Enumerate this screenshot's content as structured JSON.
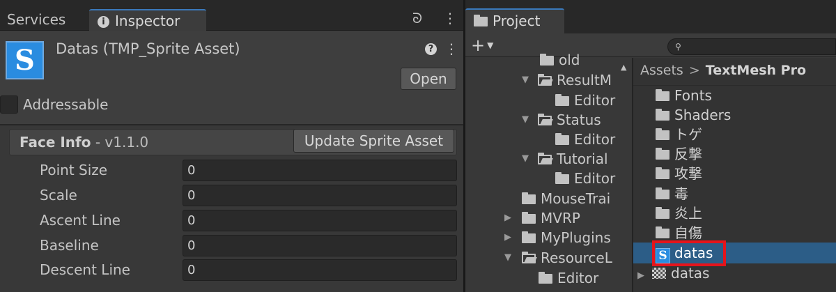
{
  "inspector": {
    "tabs": {
      "services": "Services",
      "inspector": "Inspector"
    },
    "asset": {
      "icon_letter": "S",
      "title": "Datas (TMP_Sprite Asset)",
      "open_button": "Open",
      "addressable_label": "Addressable",
      "addressable_checked": false
    },
    "face_info": {
      "title": "Face Info",
      "version": " - v1.1.0",
      "update_button": "Update Sprite Asset",
      "properties": [
        {
          "label": "Point Size",
          "value": "0"
        },
        {
          "label": "Scale",
          "value": "0"
        },
        {
          "label": "Ascent Line",
          "value": "0"
        },
        {
          "label": "Baseline",
          "value": "0"
        },
        {
          "label": "Descent Line",
          "value": "0"
        }
      ]
    }
  },
  "project": {
    "tab": "Project",
    "create_button": "+",
    "tree": [
      {
        "label": "old",
        "expanded": null
      },
      {
        "label": "ResultM",
        "expanded": true
      },
      {
        "label": "Editor",
        "expanded": null
      },
      {
        "label": "Status",
        "expanded": true
      },
      {
        "label": "Editor",
        "expanded": null
      },
      {
        "label": "Tutorial",
        "expanded": true
      },
      {
        "label": "Editor",
        "expanded": null
      },
      {
        "label": "MouseTrai",
        "expanded": null
      },
      {
        "label": "MVRP",
        "expanded": false
      },
      {
        "label": "MyPlugins",
        "expanded": false
      },
      {
        "label": "ResourceL",
        "expanded": true
      },
      {
        "label": "Editor",
        "expanded": null
      }
    ],
    "breadcrumb": {
      "root": "Assets",
      "separator": ">",
      "current": "TextMesh Pro"
    },
    "items": [
      {
        "label": "Fonts",
        "icon": "folder-icon"
      },
      {
        "label": "Shaders",
        "icon": "folder-icon"
      },
      {
        "label": "トゲ",
        "icon": "folder-icon"
      },
      {
        "label": "反撃",
        "icon": "folder-icon"
      },
      {
        "label": "攻撃",
        "icon": "folder-icon"
      },
      {
        "label": "毒",
        "icon": "folder-icon"
      },
      {
        "label": "炎上",
        "icon": "folder-icon"
      },
      {
        "label": "自傷",
        "icon": "folder-icon"
      },
      {
        "label": "datas",
        "icon": "sprite-asset-icon",
        "selected": true
      },
      {
        "label": "datas",
        "icon": "texture-icon"
      }
    ],
    "selected_color": "#2c5d87",
    "highlight_color": "#e5141b"
  }
}
